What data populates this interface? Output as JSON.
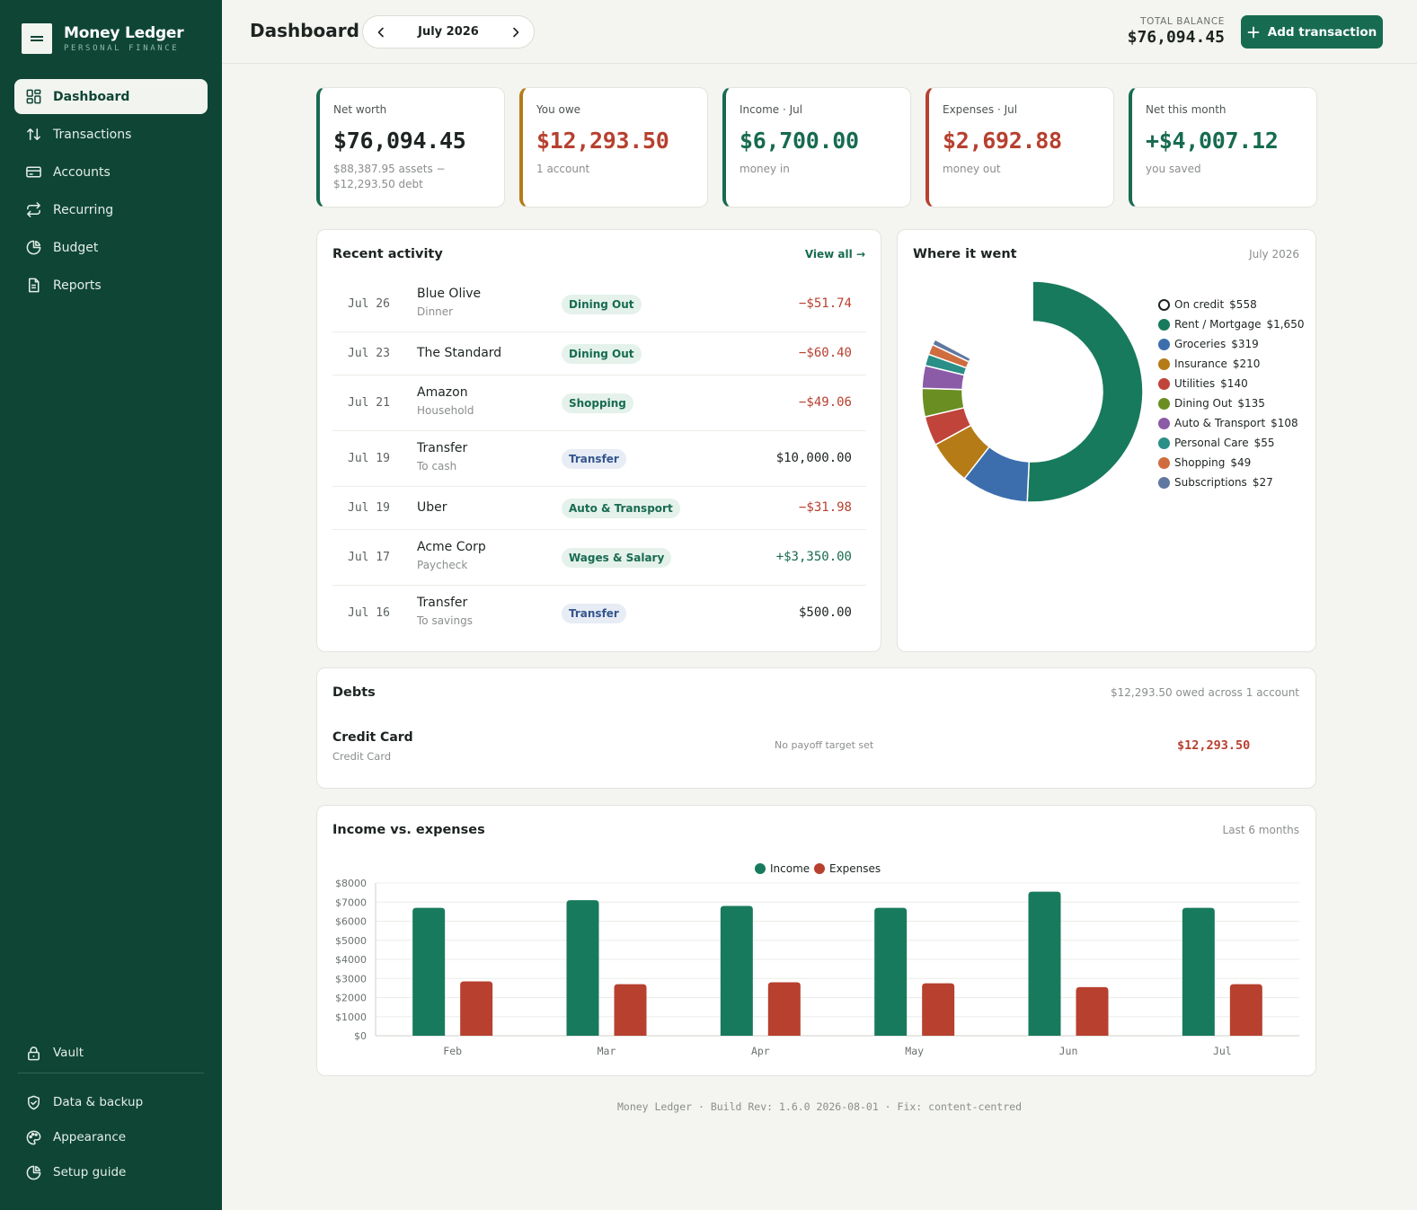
{
  "brand": {
    "name": "Money Ledger",
    "subtitle": "PERSONAL FINANCE"
  },
  "nav": [
    {
      "label": "Dashboard",
      "icon": "dashboard-icon",
      "active": true
    },
    {
      "label": "Transactions",
      "icon": "arrows-up-down-icon"
    },
    {
      "label": "Accounts",
      "icon": "credit-card-icon"
    },
    {
      "label": "Recurring",
      "icon": "repeat-icon"
    },
    {
      "label": "Budget",
      "icon": "pie-chart-icon"
    },
    {
      "label": "Reports",
      "icon": "document-icon"
    }
  ],
  "bottom_nav": [
    {
      "label": "Vault",
      "icon": "lock-icon"
    },
    {
      "label": "Data & backup",
      "icon": "shield-icon"
    },
    {
      "label": "Appearance",
      "icon": "palette-icon"
    },
    {
      "label": "Setup guide",
      "icon": "pie-chart-icon"
    }
  ],
  "header": {
    "title": "Dashboard",
    "month": "July 2026",
    "balance_label": "TOTAL BALANCE",
    "balance_value": "$76,094.45",
    "add_button": "Add transaction"
  },
  "stats": [
    {
      "label": "Net worth",
      "value": "$76,094.45",
      "sub": "$88,387.95 assets − $12,293.50 debt",
      "color": "#1d2421",
      "accent": "#176b51"
    },
    {
      "label": "You owe",
      "value": "$12,293.50",
      "sub": "1 account",
      "color": "#b7402f",
      "accent": "#b47b17"
    },
    {
      "label": "Income · Jul",
      "value": "$6,700.00",
      "sub": "money in",
      "color": "#176b51",
      "accent": "#176b51"
    },
    {
      "label": "Expenses · Jul",
      "value": "$2,692.88",
      "sub": "money out",
      "color": "#b7402f",
      "accent": "#b7402f"
    },
    {
      "label": "Net this month",
      "value": "+$4,007.12",
      "sub": "you saved",
      "color": "#176b51",
      "accent": "#176b51"
    }
  ],
  "recent": {
    "title": "Recent activity",
    "view_all": "View all →",
    "transactions": [
      {
        "date": "Jul 26",
        "name": "Blue Olive",
        "sub": "Dinner",
        "category": "Dining Out",
        "amount": "−$51.74",
        "kind": "neg"
      },
      {
        "date": "Jul 23",
        "name": "The Standard",
        "sub": "",
        "category": "Dining Out",
        "amount": "−$60.40",
        "kind": "neg"
      },
      {
        "date": "Jul 21",
        "name": "Amazon",
        "sub": "Household",
        "category": "Shopping",
        "amount": "−$49.06",
        "kind": "neg"
      },
      {
        "date": "Jul 19",
        "name": "Transfer",
        "sub": "To cash",
        "category": "Transfer",
        "amount": "$10,000.00",
        "kind": "neu"
      },
      {
        "date": "Jul 19",
        "name": "Uber",
        "sub": "",
        "category": "Auto & Transport",
        "amount": "−$31.98",
        "kind": "neg"
      },
      {
        "date": "Jul 17",
        "name": "Acme Corp",
        "sub": "Paycheck",
        "category": "Wages & Salary",
        "amount": "+$3,350.00",
        "kind": "pos"
      },
      {
        "date": "Jul 16",
        "name": "Transfer",
        "sub": "To savings",
        "category": "Transfer",
        "amount": "$500.00",
        "kind": "neu"
      }
    ]
  },
  "where": {
    "title": "Where it went",
    "period": "July 2026",
    "chart_data": {
      "type": "pie",
      "categories": [
        "On credit",
        "Rent / Mortgage",
        "Groceries",
        "Insurance",
        "Utilities",
        "Dining Out",
        "Auto & Transport",
        "Personal Care",
        "Shopping",
        "Subscriptions"
      ],
      "values": [
        558,
        1650,
        319,
        210,
        140,
        135,
        108,
        55,
        49,
        27
      ],
      "labels": [
        "$558",
        "$1,650",
        "$319",
        "$210",
        "$140",
        "$135",
        "$108",
        "$55",
        "$49",
        "$27"
      ],
      "colors": [
        "#ffffff",
        "#187a5c",
        "#3c6ead",
        "#b47b17",
        "#c0443a",
        "#6b8e23",
        "#8c5ba8",
        "#2a8f86",
        "#cf6d3f",
        "#60789f"
      ],
      "legend_position": "right"
    }
  },
  "debts": {
    "title": "Debts",
    "summary": "$12,293.50 owed across 1 account",
    "items": [
      {
        "name": "Credit Card",
        "sub": "Credit Card",
        "note": "No payoff target set",
        "amount": "$12,293.50"
      }
    ]
  },
  "income_expenses": {
    "title": "Income vs. expenses",
    "period": "Last 6 months",
    "chart_data": {
      "type": "bar",
      "categories": [
        "Feb",
        "Mar",
        "Apr",
        "May",
        "Jun",
        "Jul"
      ],
      "series": [
        {
          "name": "Income",
          "values": [
            6700,
            7100,
            6800,
            6700,
            7550,
            6700
          ],
          "color": "#187a5c"
        },
        {
          "name": "Expenses",
          "values": [
            2850,
            2700,
            2800,
            2750,
            2550,
            2700
          ],
          "color": "#b7402f"
        }
      ],
      "ylim": [
        0,
        8000
      ],
      "yticks": [
        "$0",
        "$1000",
        "$2000",
        "$3000",
        "$4000",
        "$5000",
        "$6000",
        "$7000",
        "$8000"
      ],
      "grid": true,
      "legend_position": "top"
    }
  },
  "footer": "Money Ledger · Build Rev: 1.6.0 2026-08-01 · Fix: content-centred"
}
